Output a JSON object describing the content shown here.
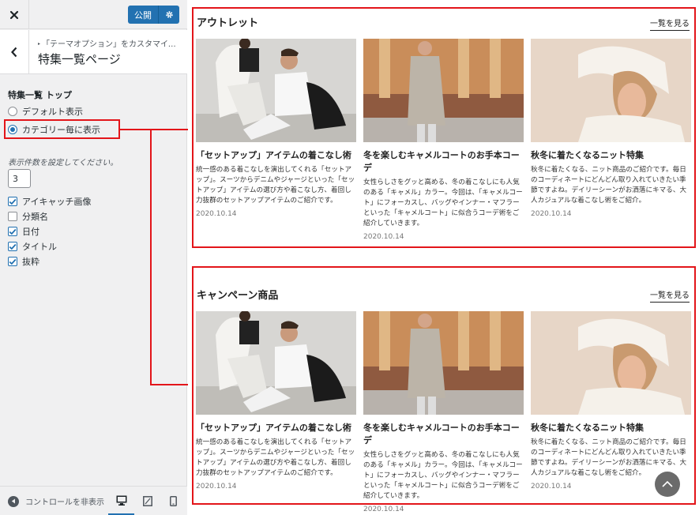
{
  "topbar": {
    "publish_label": "公開"
  },
  "section": {
    "breadcrumb": "「テーマオプション」をカスタマイズ中",
    "title": "特集一覧ページ"
  },
  "control": {
    "title": "特集一覧 トップ",
    "radios": [
      {
        "label": "デフォルト表示",
        "checked": false
      },
      {
        "label": "カテゴリー毎に表示",
        "checked": true
      }
    ],
    "count_label": "表示件数を設定してください。",
    "count_value": "3",
    "checkboxes": [
      {
        "label": "アイキャッチ画像",
        "checked": true
      },
      {
        "label": "分類名",
        "checked": false
      },
      {
        "label": "日付",
        "checked": true
      },
      {
        "label": "タイトル",
        "checked": true
      },
      {
        "label": "抜粋",
        "checked": true
      }
    ]
  },
  "footer": {
    "hide_controls_label": "コントロールを非表示"
  },
  "features": [
    {
      "title": "アウトレット",
      "see_all": "一覧を見る",
      "cards": [
        {
          "title": "「セットアップ」アイテムの着こなし術",
          "excerpt": "統一感のある着こなしを演出してくれる「セットアップ」。スーツからデニムやジャージといった「セットアップ」アイテムの選び方や着こなし方、着回し力抜群のセットアップアイテムのご紹介です。",
          "date": "2020.10.14"
        },
        {
          "title": "冬を楽しむキャメルコートのお手本コーデ",
          "excerpt": "女性らしさをグッと高める、冬の着こなしにも人気のある「キャメル」カラー。今回は、「キャメルコート」にフォーカスし、バッグやインナー・マフラーといった「キャメルコート」に似合うコーデ術をご紹介していきます。",
          "date": "2020.10.14"
        },
        {
          "title": "秋冬に着たくなるニット特集",
          "excerpt": "秋冬に着たくなる、ニット商品のご紹介です。毎日のコーディネートにどんどん取り入れていきたい季節ですよね。デイリーシーンがお洒落にキマる、大人カジュアルな着こなし術をご紹介。",
          "date": "2020.10.14"
        }
      ]
    },
    {
      "title": "キャンペーン商品",
      "see_all": "一覧を見る",
      "cards": [
        {
          "title": "「セットアップ」アイテムの着こなし術",
          "excerpt": "統一感のある着こなしを演出してくれる「セットアップ」。スーツからデニムやジャージといった「セットアップ」アイテムの選び方や着こなし方、着回し力抜群のセットアップアイテムのご紹介です。",
          "date": "2020.10.14"
        },
        {
          "title": "冬を楽しむキャメルコートのお手本コーデ",
          "excerpt": "女性らしさをグッと高める、冬の着こなしにも人気のある「キャメル」カラー。今回は、「キャメルコート」にフォーカスし、バッグやインナー・マフラーといった「キャメルコート」に似合うコーデ術をご紹介していきます。",
          "date": "2020.10.14"
        },
        {
          "title": "秋冬に着たくなるニット特集",
          "excerpt": "秋冬に着たくなる、ニット商品のご紹介です。毎日のコーディネートにどんどん取り入れていきたい季節ですよね。デイリーシーンがお洒落にキマる、大人カジュアルな着こなし術をご紹介。",
          "date": "2020.10.14"
        }
      ]
    }
  ],
  "colors": {
    "accent": "#2271b1",
    "highlight": "#e3151a"
  }
}
